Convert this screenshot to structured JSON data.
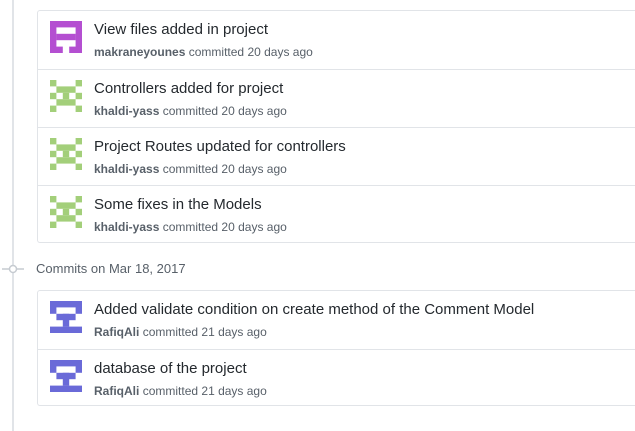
{
  "groups": [
    {
      "heading": null,
      "commits": [
        {
          "title": "View files added in project",
          "author": "makraneyounes",
          "action": "committed",
          "time": "20 days ago",
          "avatar": "identicon-purple"
        },
        {
          "title": "Controllers added for project",
          "author": "khaldi-yass",
          "action": "committed",
          "time": "20 days ago",
          "avatar": "identicon-green"
        },
        {
          "title": "Project Routes updated for controllers",
          "author": "khaldi-yass",
          "action": "committed",
          "time": "20 days ago",
          "avatar": "identicon-green"
        },
        {
          "title": "Some fixes in the Models",
          "author": "khaldi-yass",
          "action": "committed",
          "time": "20 days ago",
          "avatar": "identicon-green"
        }
      ]
    },
    {
      "heading": "Commits on Mar 18, 2017",
      "commits": [
        {
          "title": "Added validate condition on create method of the Comment Model",
          "author": "RafiqAli",
          "action": "committed",
          "time": "21 days ago",
          "avatar": "identicon-blue"
        },
        {
          "title": "database of the project",
          "author": "RafiqAli",
          "action": "committed",
          "time": "21 days ago",
          "avatar": "identicon-blue"
        }
      ]
    }
  ],
  "colors": {
    "identicon-purple": "#b44fd1",
    "identicon-green": "#a3cf7a",
    "identicon-blue": "#6a6ad8"
  }
}
